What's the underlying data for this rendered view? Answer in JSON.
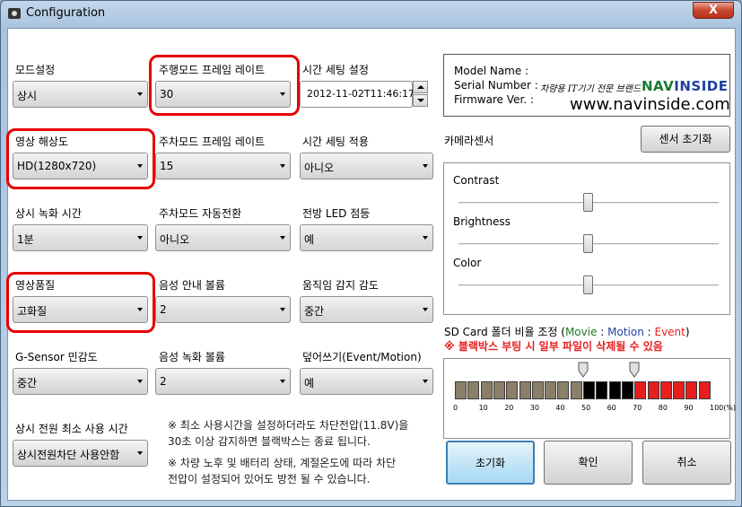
{
  "window": {
    "title": "Configuration",
    "close_label": "X"
  },
  "col1": [
    {
      "label": "모드설정",
      "value": "상시"
    },
    {
      "label": "영상 해상도",
      "value": "HD(1280x720)"
    },
    {
      "label": "상시 녹화 시간",
      "value": "1분"
    },
    {
      "label": "영상품질",
      "value": "고화질"
    },
    {
      "label": "G-Sensor 민감도",
      "value": "중간"
    }
  ],
  "col2": [
    {
      "label": "주행모드 프레임 레이트",
      "value": "30"
    },
    {
      "label": "주차모드 프레임 레이트",
      "value": "15"
    },
    {
      "label": "주차모드 자동전환",
      "value": "아니오"
    },
    {
      "label": "음성 안내 볼륨",
      "value": "2"
    },
    {
      "label": "음성 녹화 볼륨",
      "value": "2"
    }
  ],
  "col3": [
    {
      "label": "시간 세팅 설정",
      "value": "2012-11-02T11:46:17"
    },
    {
      "label": "시간 세팅 적용",
      "value": "아니오"
    },
    {
      "label": "전방 LED 점등",
      "value": "예"
    },
    {
      "label": "움직임 감지 감도",
      "value": "중간"
    },
    {
      "label": "덮어쓰기(Event/Motion)",
      "value": "예"
    }
  ],
  "power": {
    "label": "상시 전원 최소 사용 시간",
    "value": "상시전원차단 사용안함"
  },
  "notes": [
    "※ 최소 사용시간을 설정하더라도 차단전압(11.8V)을",
    "30초 이상 감지하면 블랙박스는 종료 됩니다.",
    "※ 차량 노후 및 배터리 상태, 계절온도에 따라 차단",
    "전압이 설정되어 있어도 방전 될 수 있습니다."
  ],
  "info": {
    "model_label": "Model Name :",
    "serial_label": "Serial Number :",
    "firmware_label": "Firmware Ver. :",
    "handwriting": "차량용 IT기기 전문 브랜드",
    "logo_navi": "NAV",
    "logo_inside": "INSIDE",
    "website": "www.navinside.com"
  },
  "camera": {
    "label": "카메라센서",
    "reset_button": "센서 초기화",
    "sliders": [
      {
        "label": "Contrast",
        "value": 0.5
      },
      {
        "label": "Brightness",
        "value": 0.5
      },
      {
        "label": "Color",
        "value": 0.5
      }
    ]
  },
  "sdcard": {
    "title_prefix": "SD Card 폴더 비율 조정 (",
    "movie": "Movie",
    "sep1": " : ",
    "motion": "Motion",
    "sep2": " : ",
    "event": "Event",
    "title_suffix": ")",
    "warning": "※ 블랙박스 부팅 시 일부 파일이 삭제될 수 있음",
    "movie_pct": 50,
    "motion_pct": 70,
    "ticks": [
      "0",
      "10",
      "20",
      "30",
      "40",
      "50",
      "60",
      "70",
      "80",
      "90",
      "100(%)"
    ],
    "colors": {
      "movie": "#8b7f6a",
      "motion": "#000000",
      "event": "#e61e1e"
    }
  },
  "buttons": {
    "reset": "초기화",
    "ok": "확인",
    "cancel": "취소"
  }
}
